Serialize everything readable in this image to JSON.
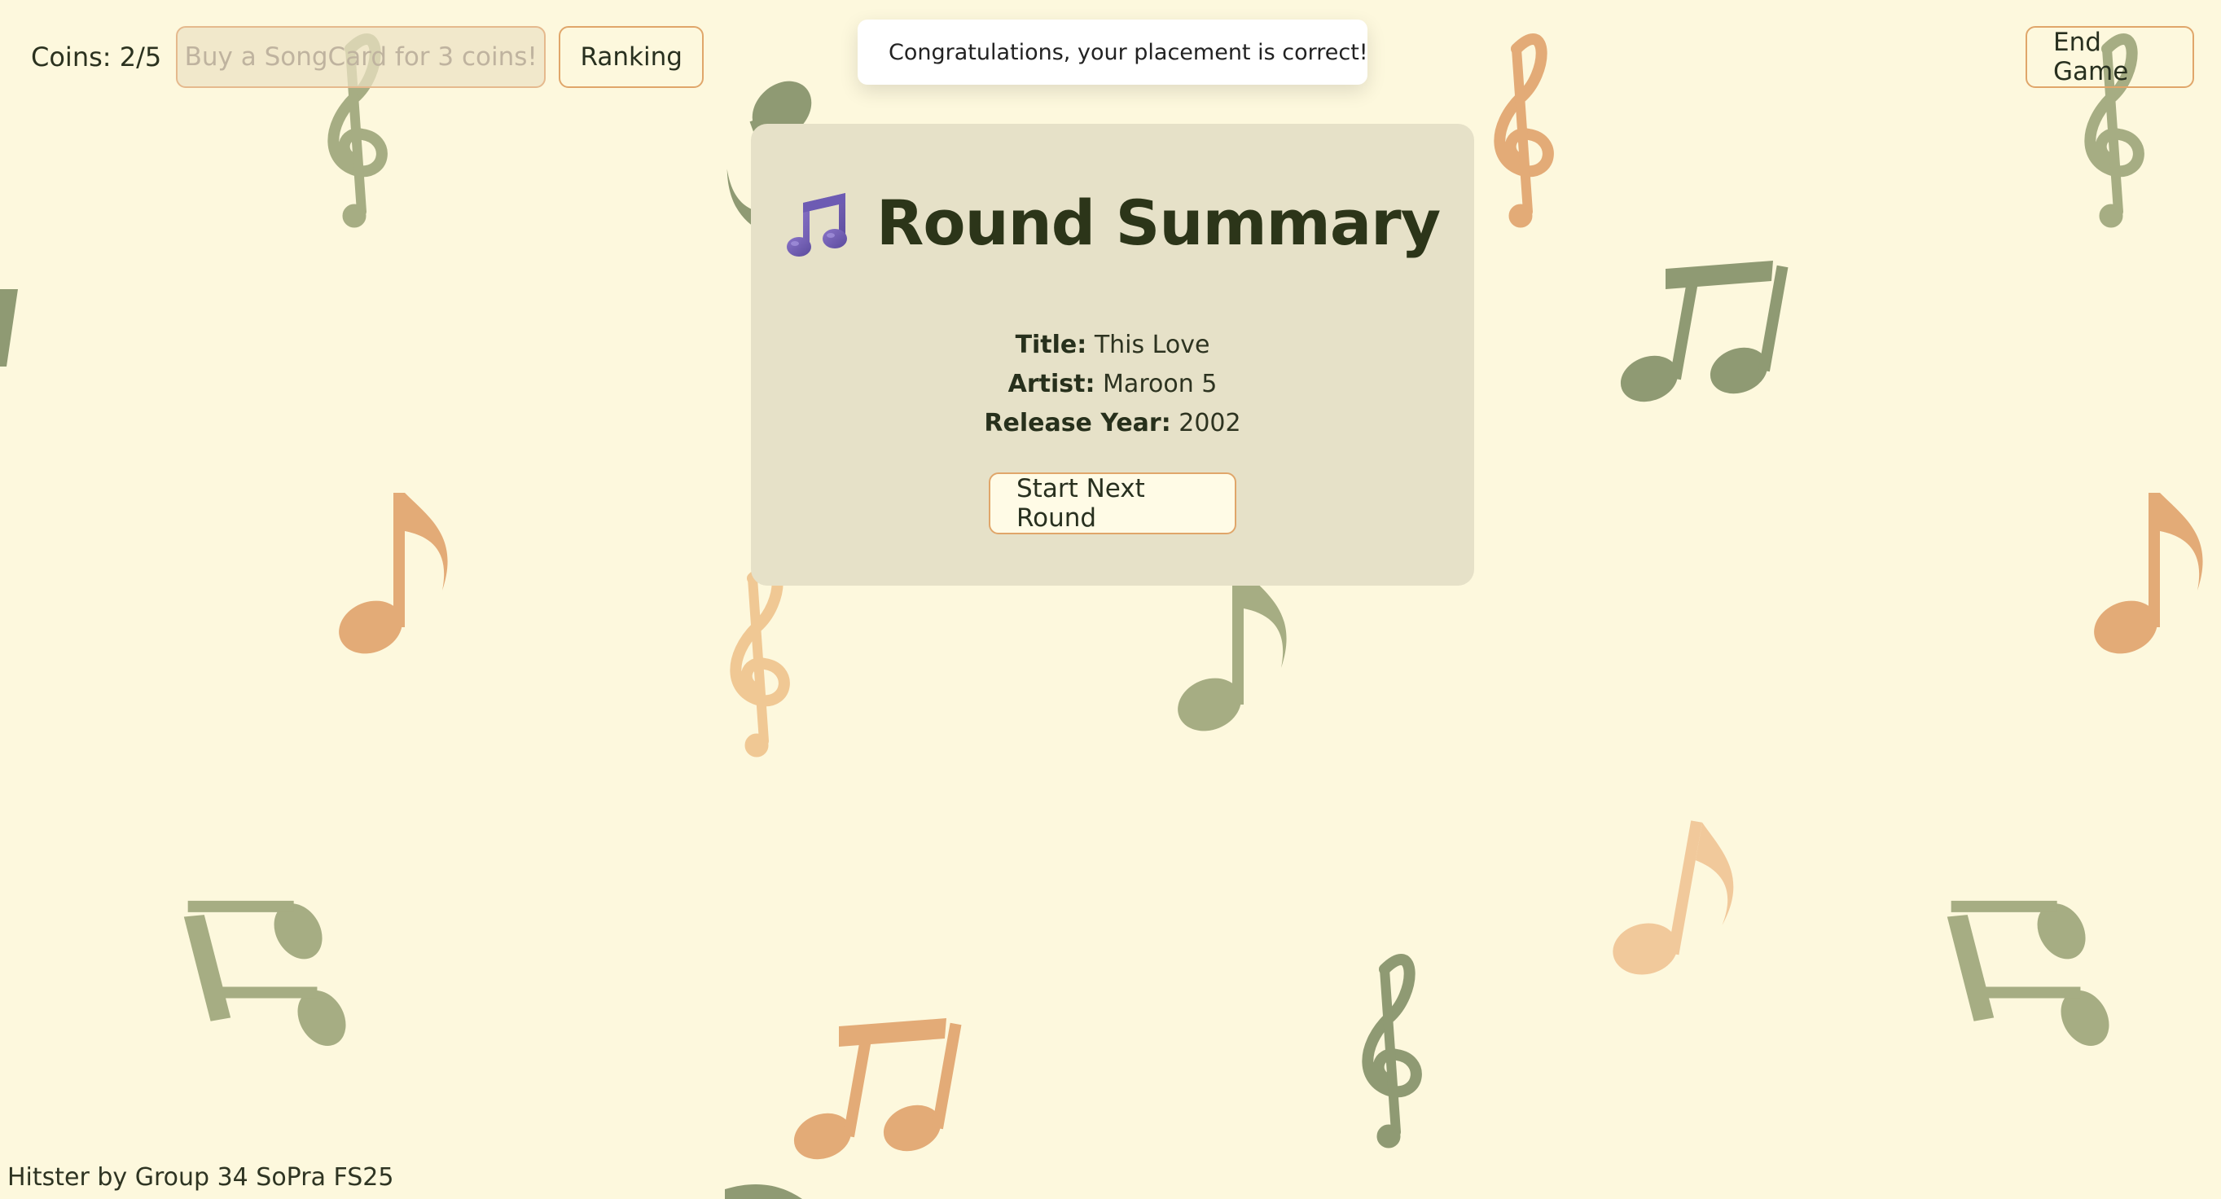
{
  "topbar": {
    "coins_label": "Coins: 2/5",
    "buy_label": "Buy a SongCard for 3 coins!",
    "ranking_label": "Ranking",
    "end_game_label": "End Game"
  },
  "toast": {
    "icon": "check-circle-icon",
    "message": "Congratulations, your placement is correct!"
  },
  "summary": {
    "icon": "music-notes-icon",
    "title": "Round Summary",
    "title_label": "Title:",
    "title_value": "This Love",
    "artist_label": "Artist:",
    "artist_value": "Maroon 5",
    "year_label": "Release Year:",
    "year_value": "2002",
    "next_label": "Start Next Round"
  },
  "footer": {
    "text": "Hitster by Group 34 SoPra FS25"
  },
  "colors": {
    "background": "#fdf8dd",
    "card": "#e6e1c8",
    "accent_border": "#e0a66a",
    "note_green": "#8f9a73",
    "note_orange": "#e3ab77"
  }
}
